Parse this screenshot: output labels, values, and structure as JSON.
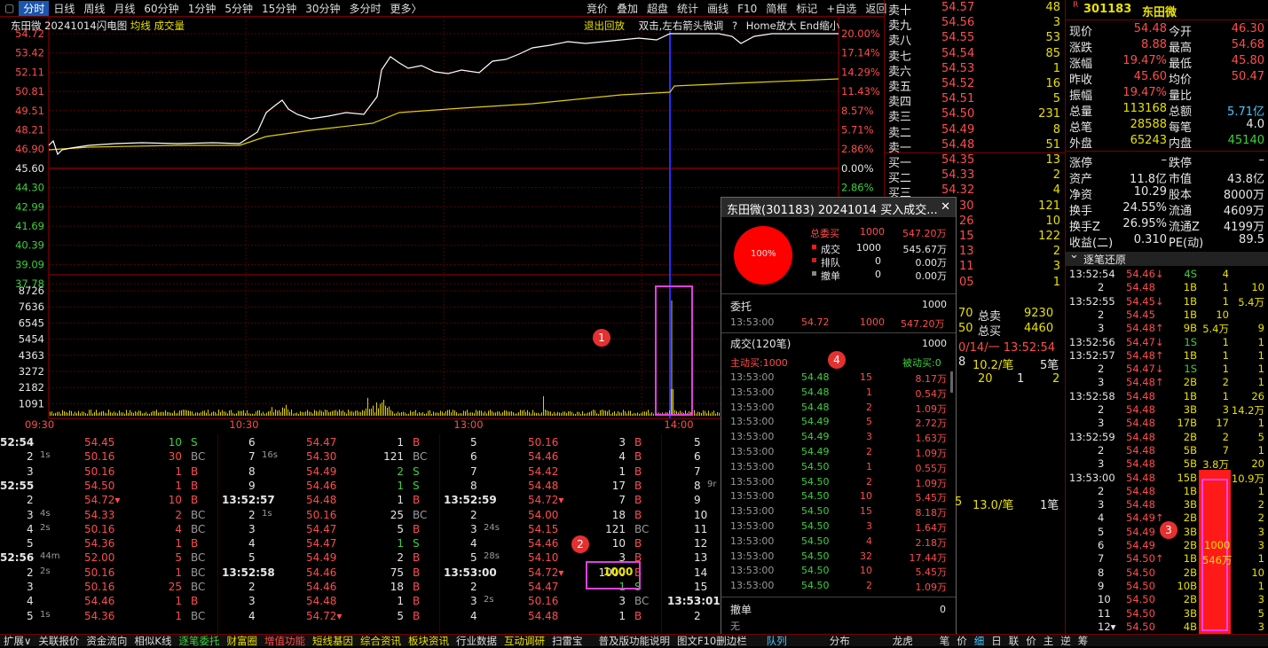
{
  "topbar": {
    "tabs": [
      "分时",
      "日线",
      "周线",
      "月线",
      "60分钟",
      "1分钟",
      "5分钟",
      "15分钟",
      "30分钟",
      "多分时",
      "更多〉"
    ],
    "tools": [
      "竞价",
      "叠加",
      "超盘",
      "统计",
      "画线",
      "F10",
      "简框",
      "标记",
      "+自选",
      "返回"
    ]
  },
  "chart": {
    "title": "东田微",
    "date_label": "20241014闪电图",
    "avg_label": "均线",
    "vol_label": "成交量",
    "exit_replay": "退出回放",
    "hint": "双击,左右箭头微调",
    "help": "?",
    "zoom_hint": "Home放大 End缩小",
    "price_ticks": [
      "54.72",
      "53.42",
      "52.11",
      "50.81",
      "49.51",
      "48.21",
      "46.90",
      "45.60",
      "44.30",
      "42.99",
      "41.69",
      "40.39",
      "39.09",
      "37.78"
    ],
    "pct_ticks": [
      "20.00%",
      "17.14%",
      "14.29%",
      "11.43%",
      "8.57%",
      "5.71%",
      "2.86%",
      "0.00%",
      "2.86%",
      "5.71%"
    ],
    "vol_ticks": [
      "8726",
      "7636",
      "6545",
      "5454",
      "4363",
      "3272",
      "2182",
      "1091"
    ],
    "time_ticks": [
      "09:30",
      "10:30",
      "13:00",
      "14:00"
    ]
  },
  "detail": {
    "cols": [
      [
        [
          "52:54",
          "",
          "54.45",
          "10",
          "S"
        ],
        [
          "2",
          "1s",
          "50.16",
          "30",
          "BC"
        ],
        [
          "3",
          "",
          "50.16",
          "1",
          "B"
        ],
        [
          "52:55",
          "",
          "54.50",
          "1",
          "B"
        ],
        [
          "2",
          "",
          "54.72▾",
          "10",
          "B"
        ],
        [
          "3",
          "4s",
          "54.33",
          "2",
          "BC"
        ],
        [
          "4",
          "2s",
          "50.16",
          "4",
          "BC"
        ],
        [
          "5",
          "",
          "54.36",
          "1",
          "B"
        ],
        [
          "52:56",
          "44m",
          "52.00",
          "5",
          "BC"
        ],
        [
          "2",
          "2s",
          "50.16",
          "1",
          "BC"
        ],
        [
          "3",
          "",
          "50.16",
          "25",
          "BC"
        ],
        [
          "4",
          "",
          "54.46",
          "1",
          "B"
        ],
        [
          "5",
          "1s",
          "54.36",
          "1",
          "BC"
        ]
      ],
      [
        [
          "6",
          "",
          "54.47",
          "1",
          "B"
        ],
        [
          "7",
          "16s",
          "54.30",
          "121",
          "BC"
        ],
        [
          "8",
          "",
          "54.49",
          "2",
          "S"
        ],
        [
          "9",
          "",
          "54.46",
          "1",
          "S"
        ],
        [
          "13:52:57",
          "",
          "54.48",
          "1",
          "B"
        ],
        [
          "2",
          "1s",
          "50.16",
          "25",
          "BC"
        ],
        [
          "3",
          "",
          "54.47",
          "5",
          "B"
        ],
        [
          "4",
          "",
          "54.47",
          "1",
          "S"
        ],
        [
          "5",
          "",
          "54.49",
          "2",
          "B"
        ],
        [
          "13:52:58",
          "",
          "54.46",
          "75",
          "B"
        ],
        [
          "2",
          "",
          "54.46",
          "18",
          "B"
        ],
        [
          "3",
          "",
          "54.48",
          "1",
          "B"
        ],
        [
          "4",
          "",
          "54.72▾",
          "5",
          "B"
        ]
      ],
      [
        [
          "5",
          "",
          "50.16",
          "3",
          "B"
        ],
        [
          "6",
          "",
          "54.46",
          "4",
          "B"
        ],
        [
          "7",
          "",
          "54.42",
          "1",
          "B"
        ],
        [
          "8",
          "",
          "54.48",
          "17",
          "B"
        ],
        [
          "13:52:59",
          "",
          "54.72▾",
          "7",
          "B"
        ],
        [
          "2",
          "",
          "54.00",
          "18",
          "B"
        ],
        [
          "3",
          "24s",
          "54.15",
          "121",
          "BC"
        ],
        [
          "4",
          "",
          "54.46",
          "10",
          "B"
        ],
        [
          "5",
          "28s",
          "54.10",
          "3",
          "B"
        ],
        [
          "13:53:00",
          "",
          "54.72▾",
          "1000",
          "B"
        ],
        [
          "2",
          "",
          "54.47",
          "1",
          "S"
        ],
        [
          "3",
          "2s",
          "50.16",
          "3",
          "BC"
        ],
        [
          "4",
          "",
          "54.48",
          "1",
          "B"
        ]
      ],
      [
        [
          "5"
        ],
        [
          "6"
        ],
        [
          "7"
        ],
        [
          "8",
          "9r"
        ],
        [
          "9"
        ],
        [
          "10"
        ],
        [
          "11"
        ],
        [
          "12"
        ],
        [
          "13"
        ],
        [
          "14"
        ],
        [
          "15"
        ],
        [
          "13:53:01"
        ],
        [
          "2"
        ]
      ]
    ]
  },
  "orderbook": {
    "asks": [
      [
        "卖十",
        "54.57",
        "48"
      ],
      [
        "卖九",
        "54.56",
        "3"
      ],
      [
        "卖八",
        "54.55",
        "53"
      ],
      [
        "卖七",
        "54.54",
        "85"
      ],
      [
        "卖六",
        "54.53",
        "1"
      ],
      [
        "卖五",
        "54.52",
        "16"
      ],
      [
        "卖四",
        "54.51",
        "5"
      ],
      [
        "卖三",
        "54.50",
        "231"
      ],
      [
        "卖二",
        "54.49",
        "8"
      ],
      [
        "卖一",
        "54.48",
        "51"
      ]
    ],
    "bids": [
      [
        "买一",
        "54.35",
        "13"
      ],
      [
        "买二",
        "54.33",
        "2"
      ],
      [
        "买三",
        "54.32",
        "4"
      ],
      [
        "",
        "30",
        "121"
      ],
      [
        "",
        "26",
        "10"
      ],
      [
        "",
        "15",
        "122"
      ],
      [
        "",
        "13",
        "2"
      ],
      [
        "",
        "11",
        "3"
      ],
      [
        "",
        "05",
        "1"
      ]
    ],
    "sum_sell_label": "总卖",
    "sum_sell": "9230",
    "sum_buy_label": "总买",
    "sum_buy": "4460",
    "sum_prefix": "70",
    "sum_prefix2": "50",
    "time_line": "0/14/一 13:52:54",
    "line2_a": "8",
    "line2_b": "10.2/笔",
    "line2_c": "5笔",
    "line3_a": "20",
    "line3_b": "1",
    "line3_c": "2",
    "line4_a": "5",
    "line4_b": "13.0/笔",
    "line4_c": "1笔"
  },
  "quote": {
    "code_tag": "R",
    "code": "301183",
    "name": "东田微",
    "rows": [
      [
        "现价",
        "54.48",
        "今开",
        "46.30"
      ],
      [
        "涨跌",
        "8.88",
        "最高",
        "54.68"
      ],
      [
        "涨幅",
        "19.47%",
        "最低",
        "45.80"
      ],
      [
        "昨收",
        "45.60",
        "均价",
        "50.47"
      ],
      [
        "振幅",
        "19.47%",
        "量比",
        ""
      ],
      [
        "总量",
        "113168",
        "总额",
        "5.71亿"
      ],
      [
        "总笔",
        "28588",
        "每笔",
        "4.0"
      ],
      [
        "外盘",
        "65243",
        "内盘",
        "45140"
      ]
    ],
    "rows2": [
      [
        "涨停",
        "–",
        "跌停",
        "–"
      ],
      [
        "资产",
        "11.8亿",
        "市值",
        "43.8亿"
      ],
      [
        "净资",
        "10.29",
        "股本",
        "8000万"
      ],
      [
        "换手",
        "24.55%",
        "流通",
        "4609万"
      ],
      [
        "换手Z",
        "26.95%",
        "流通Z",
        "4199万"
      ],
      [
        "收益(二)",
        "0.310",
        "PE(动)",
        "89.5"
      ]
    ],
    "ticks_title": "逐笔还原"
  },
  "ticks": [
    [
      "13:52:54",
      "54.46↓",
      "4S",
      "4",
      ""
    ],
    [
      "2",
      "54.48",
      "1B",
      "1",
      "10"
    ],
    [
      "13:52:55",
      "54.45↓",
      "1B",
      "1",
      "5.4万"
    ],
    [
      "2",
      "54.45",
      "1B",
      "10",
      ""
    ],
    [
      "3",
      "54.48↑",
      "9B",
      "5.4万",
      "9"
    ],
    [
      "13:52:56",
      "54.47↓",
      "1S",
      "1",
      "1"
    ],
    [
      "13:52:57",
      "54.48↑",
      "1B",
      "1",
      "1"
    ],
    [
      "2",
      "54.47↓",
      "1S",
      "1",
      "1"
    ],
    [
      "3",
      "54.48↑",
      "2B",
      "2",
      "1"
    ],
    [
      "13:52:58",
      "54.48",
      "1B",
      "1",
      "26"
    ],
    [
      "2",
      "54.48",
      "3B",
      "3",
      "14.2万"
    ],
    [
      "3",
      "54.48",
      "17B",
      "17",
      "1"
    ],
    [
      "13:52:59",
      "54.48",
      "2B",
      "2",
      "5"
    ],
    [
      "2",
      "54.48",
      "5B",
      "7",
      "1"
    ],
    [
      "3",
      "54.48",
      "5B",
      "3.8万",
      "20"
    ],
    [
      "13:53:00",
      "54.48",
      "15B",
      "",
      "10.9万"
    ],
    [
      "2",
      "54.48",
      "1B",
      "",
      "1"
    ],
    [
      "3",
      "54.48",
      "3B",
      "",
      "2"
    ],
    [
      "4",
      "54.49↑",
      "2B",
      "",
      "2"
    ],
    [
      "5",
      "54.49",
      "3B",
      "",
      "3"
    ],
    [
      "6",
      "54.49",
      "2B",
      "",
      "3"
    ],
    [
      "7",
      "54.50↑",
      "1B",
      "",
      "1"
    ],
    [
      "8",
      "54.50",
      "2B",
      "",
      "10"
    ],
    [
      "9",
      "54.50",
      "10B",
      "",
      "1"
    ],
    [
      "10",
      "54.50",
      "2B",
      "",
      "3"
    ],
    [
      "11",
      "54.50",
      "3B",
      "",
      "5"
    ],
    [
      "12▾",
      "54.50",
      "4B",
      "",
      "3"
    ]
  ],
  "ticks_bar": {
    "qty": "1000",
    "amt": "546万"
  },
  "popup": {
    "title": "东田微(301183) 20241014 买入成交...",
    "close": "✕",
    "pie_label": "100%",
    "total_label": "总委买",
    "total_qty": "1000",
    "total_amt": "547.20万",
    "legend": [
      [
        "成交",
        "1000",
        "545.67万"
      ],
      [
        "排队",
        "0",
        "0.00万"
      ],
      [
        "撤单",
        "0",
        "0.00万"
      ]
    ],
    "entrust_label": "委托",
    "entrust_qty": "1000",
    "entrust_row": [
      "13:53:00",
      "54.72",
      "1000",
      "547.20万"
    ],
    "deal_label": "成交(120笔)",
    "deal_qty": "1000",
    "active_buy": "主动买:1000",
    "passive_buy": "被动买:0",
    "rows": [
      [
        "13:53:00",
        "54.48",
        "15",
        "8.17万"
      ],
      [
        "13:53:00",
        "54.48",
        "1",
        "0.54万"
      ],
      [
        "13:53:00",
        "54.48",
        "2",
        "1.09万"
      ],
      [
        "13:53:00",
        "54.49",
        "5",
        "2.72万"
      ],
      [
        "13:53:00",
        "54.49",
        "3",
        "1.63万"
      ],
      [
        "13:53:00",
        "54.49",
        "2",
        "1.09万"
      ],
      [
        "13:53:00",
        "54.50",
        "1",
        "0.55万"
      ],
      [
        "13:53:00",
        "54.50",
        "2",
        "1.09万"
      ],
      [
        "13:53:00",
        "54.50",
        "10",
        "5.45万"
      ],
      [
        "13:53:00",
        "54.50",
        "15",
        "8.18万"
      ],
      [
        "13:53:00",
        "54.50",
        "3",
        "1.64万"
      ],
      [
        "13:53:00",
        "54.50",
        "4",
        "2.18万"
      ],
      [
        "13:53:00",
        "54.50",
        "32",
        "17.44万"
      ],
      [
        "13:53:00",
        "54.50",
        "10",
        "5.45万"
      ],
      [
        "13:53:00",
        "54.50",
        "2",
        "1.09万"
      ]
    ],
    "cancel_label": "撤单",
    "cancel_qty": "0",
    "cancel_none": "无"
  },
  "bottombar": [
    "扩展∨",
    "关联报价",
    "资金流向",
    "相似K线",
    "逐笔委托",
    "财富圈",
    "增值功能",
    "短线基因",
    "综合资讯",
    "板块资讯",
    "行业数据",
    "互动调研",
    "扫雷宝",
    "普及版功能说明",
    "图文F10删边栏",
    "队列",
    "分布",
    "龙虎",
    "笔",
    "价",
    "细",
    "日",
    "联",
    "价",
    "主",
    "逆",
    "筹"
  ],
  "badges": [
    "1",
    "2",
    "3",
    "4"
  ],
  "highlight": {
    "qty": "1000"
  }
}
